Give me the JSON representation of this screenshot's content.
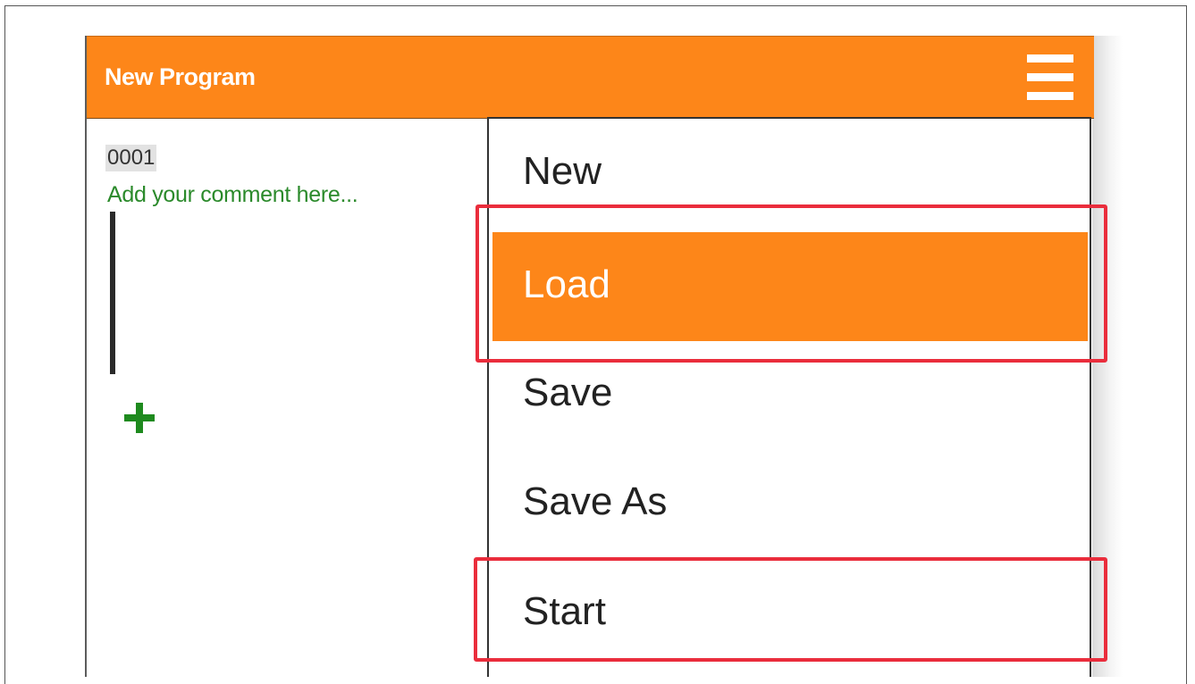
{
  "app": {
    "title": "New Program"
  },
  "program": {
    "id": "0001",
    "comment_placeholder": "Add your comment here..."
  },
  "menu": {
    "items": [
      {
        "label": "New"
      },
      {
        "label": "Load",
        "active": true
      },
      {
        "label": "Save"
      },
      {
        "label": "Save As"
      },
      {
        "label": "Start"
      }
    ]
  },
  "colors": {
    "accent": "#fd8619",
    "highlight": "#ea2d3c",
    "comment": "#2b8a2b",
    "add": "#1e8a1e"
  },
  "icons": {
    "menu": "hamburger-icon",
    "add": "plus-icon"
  }
}
